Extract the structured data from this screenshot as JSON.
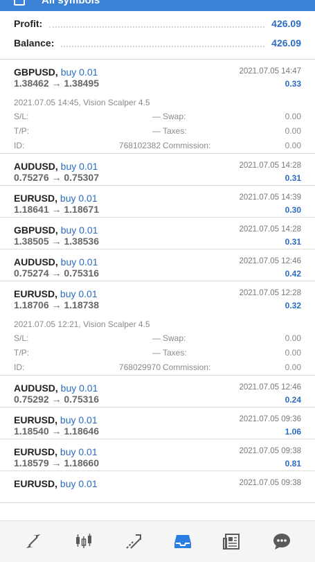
{
  "header": {
    "title": "All symbols"
  },
  "summary": {
    "profit_label": "Profit:",
    "profit_value": "426.09",
    "balance_label": "Balance:",
    "balance_value": "426.09"
  },
  "deals": [
    {
      "symbol": "GBPUSD,",
      "side": "buy 0.01",
      "prices": "1.38462 → 1.38495",
      "time": "2021.07.05 14:47",
      "profit": "0.33",
      "expanded": true,
      "details": {
        "open_info": "2021.07.05 14:45, Vision Scalper 4.5",
        "sl_label": "S/L:",
        "sl_value": "—",
        "tp_label": "T/P:",
        "tp_value": "—",
        "id_label": "ID:",
        "id_value": "768102382",
        "swap_label": "Swap:",
        "swap_value": "0.00",
        "taxes_label": "Taxes:",
        "taxes_value": "0.00",
        "commission_label": "Commission:",
        "commission_value": "0.00"
      }
    },
    {
      "symbol": "AUDUSD,",
      "side": "buy 0.01",
      "prices": "0.75276 → 0.75307",
      "time": "2021.07.05 14:28",
      "profit": "0.31"
    },
    {
      "symbol": "EURUSD,",
      "side": "buy 0.01",
      "prices": "1.18641 → 1.18671",
      "time": "2021.07.05 14:39",
      "profit": "0.30"
    },
    {
      "symbol": "GBPUSD,",
      "side": "buy 0.01",
      "prices": "1.38505 → 1.38536",
      "time": "2021.07.05 14:28",
      "profit": "0.31"
    },
    {
      "symbol": "AUDUSD,",
      "side": "buy 0.01",
      "prices": "0.75274 → 0.75316",
      "time": "2021.07.05 12:46",
      "profit": "0.42"
    },
    {
      "symbol": "EURUSD,",
      "side": "buy 0.01",
      "prices": "1.18706 → 1.18738",
      "time": "2021.07.05 12:28",
      "profit": "0.32",
      "expanded": true,
      "details": {
        "open_info": "2021.07.05 12:21, Vision Scalper 4.5",
        "sl_label": "S/L:",
        "sl_value": "—",
        "tp_label": "T/P:",
        "tp_value": "—",
        "id_label": "ID:",
        "id_value": "768029970",
        "swap_label": "Swap:",
        "swap_value": "0.00",
        "taxes_label": "Taxes:",
        "taxes_value": "0.00",
        "commission_label": "Commission:",
        "commission_value": "0.00"
      }
    },
    {
      "symbol": "AUDUSD,",
      "side": "buy 0.01",
      "prices": "0.75292 → 0.75316",
      "time": "2021.07.05 12:46",
      "profit": "0.24"
    },
    {
      "symbol": "EURUSD,",
      "side": "buy 0.01",
      "prices": "1.18540 → 1.18646",
      "time": "2021.07.05 09:36",
      "profit": "1.06"
    },
    {
      "symbol": "EURUSD,",
      "side": "buy 0.01",
      "prices": "1.18579 → 1.18660",
      "time": "2021.07.05 09:38",
      "profit": "0.81"
    },
    {
      "symbol": "EURUSD,",
      "side": "buy 0.01",
      "prices": "",
      "time": "2021.07.05 09:38",
      "profit": ""
    }
  ],
  "bottom_nav": [
    {
      "name": "quotes-icon",
      "active": false
    },
    {
      "name": "chart-icon",
      "active": false
    },
    {
      "name": "trade-icon",
      "active": false
    },
    {
      "name": "history-icon",
      "active": true
    },
    {
      "name": "news-icon",
      "active": false
    },
    {
      "name": "chat-icon",
      "active": false
    }
  ],
  "colors": {
    "accent": "#2a6bc4",
    "nav_icon": "#5a5a5a",
    "nav_active": "#2a7de1"
  }
}
